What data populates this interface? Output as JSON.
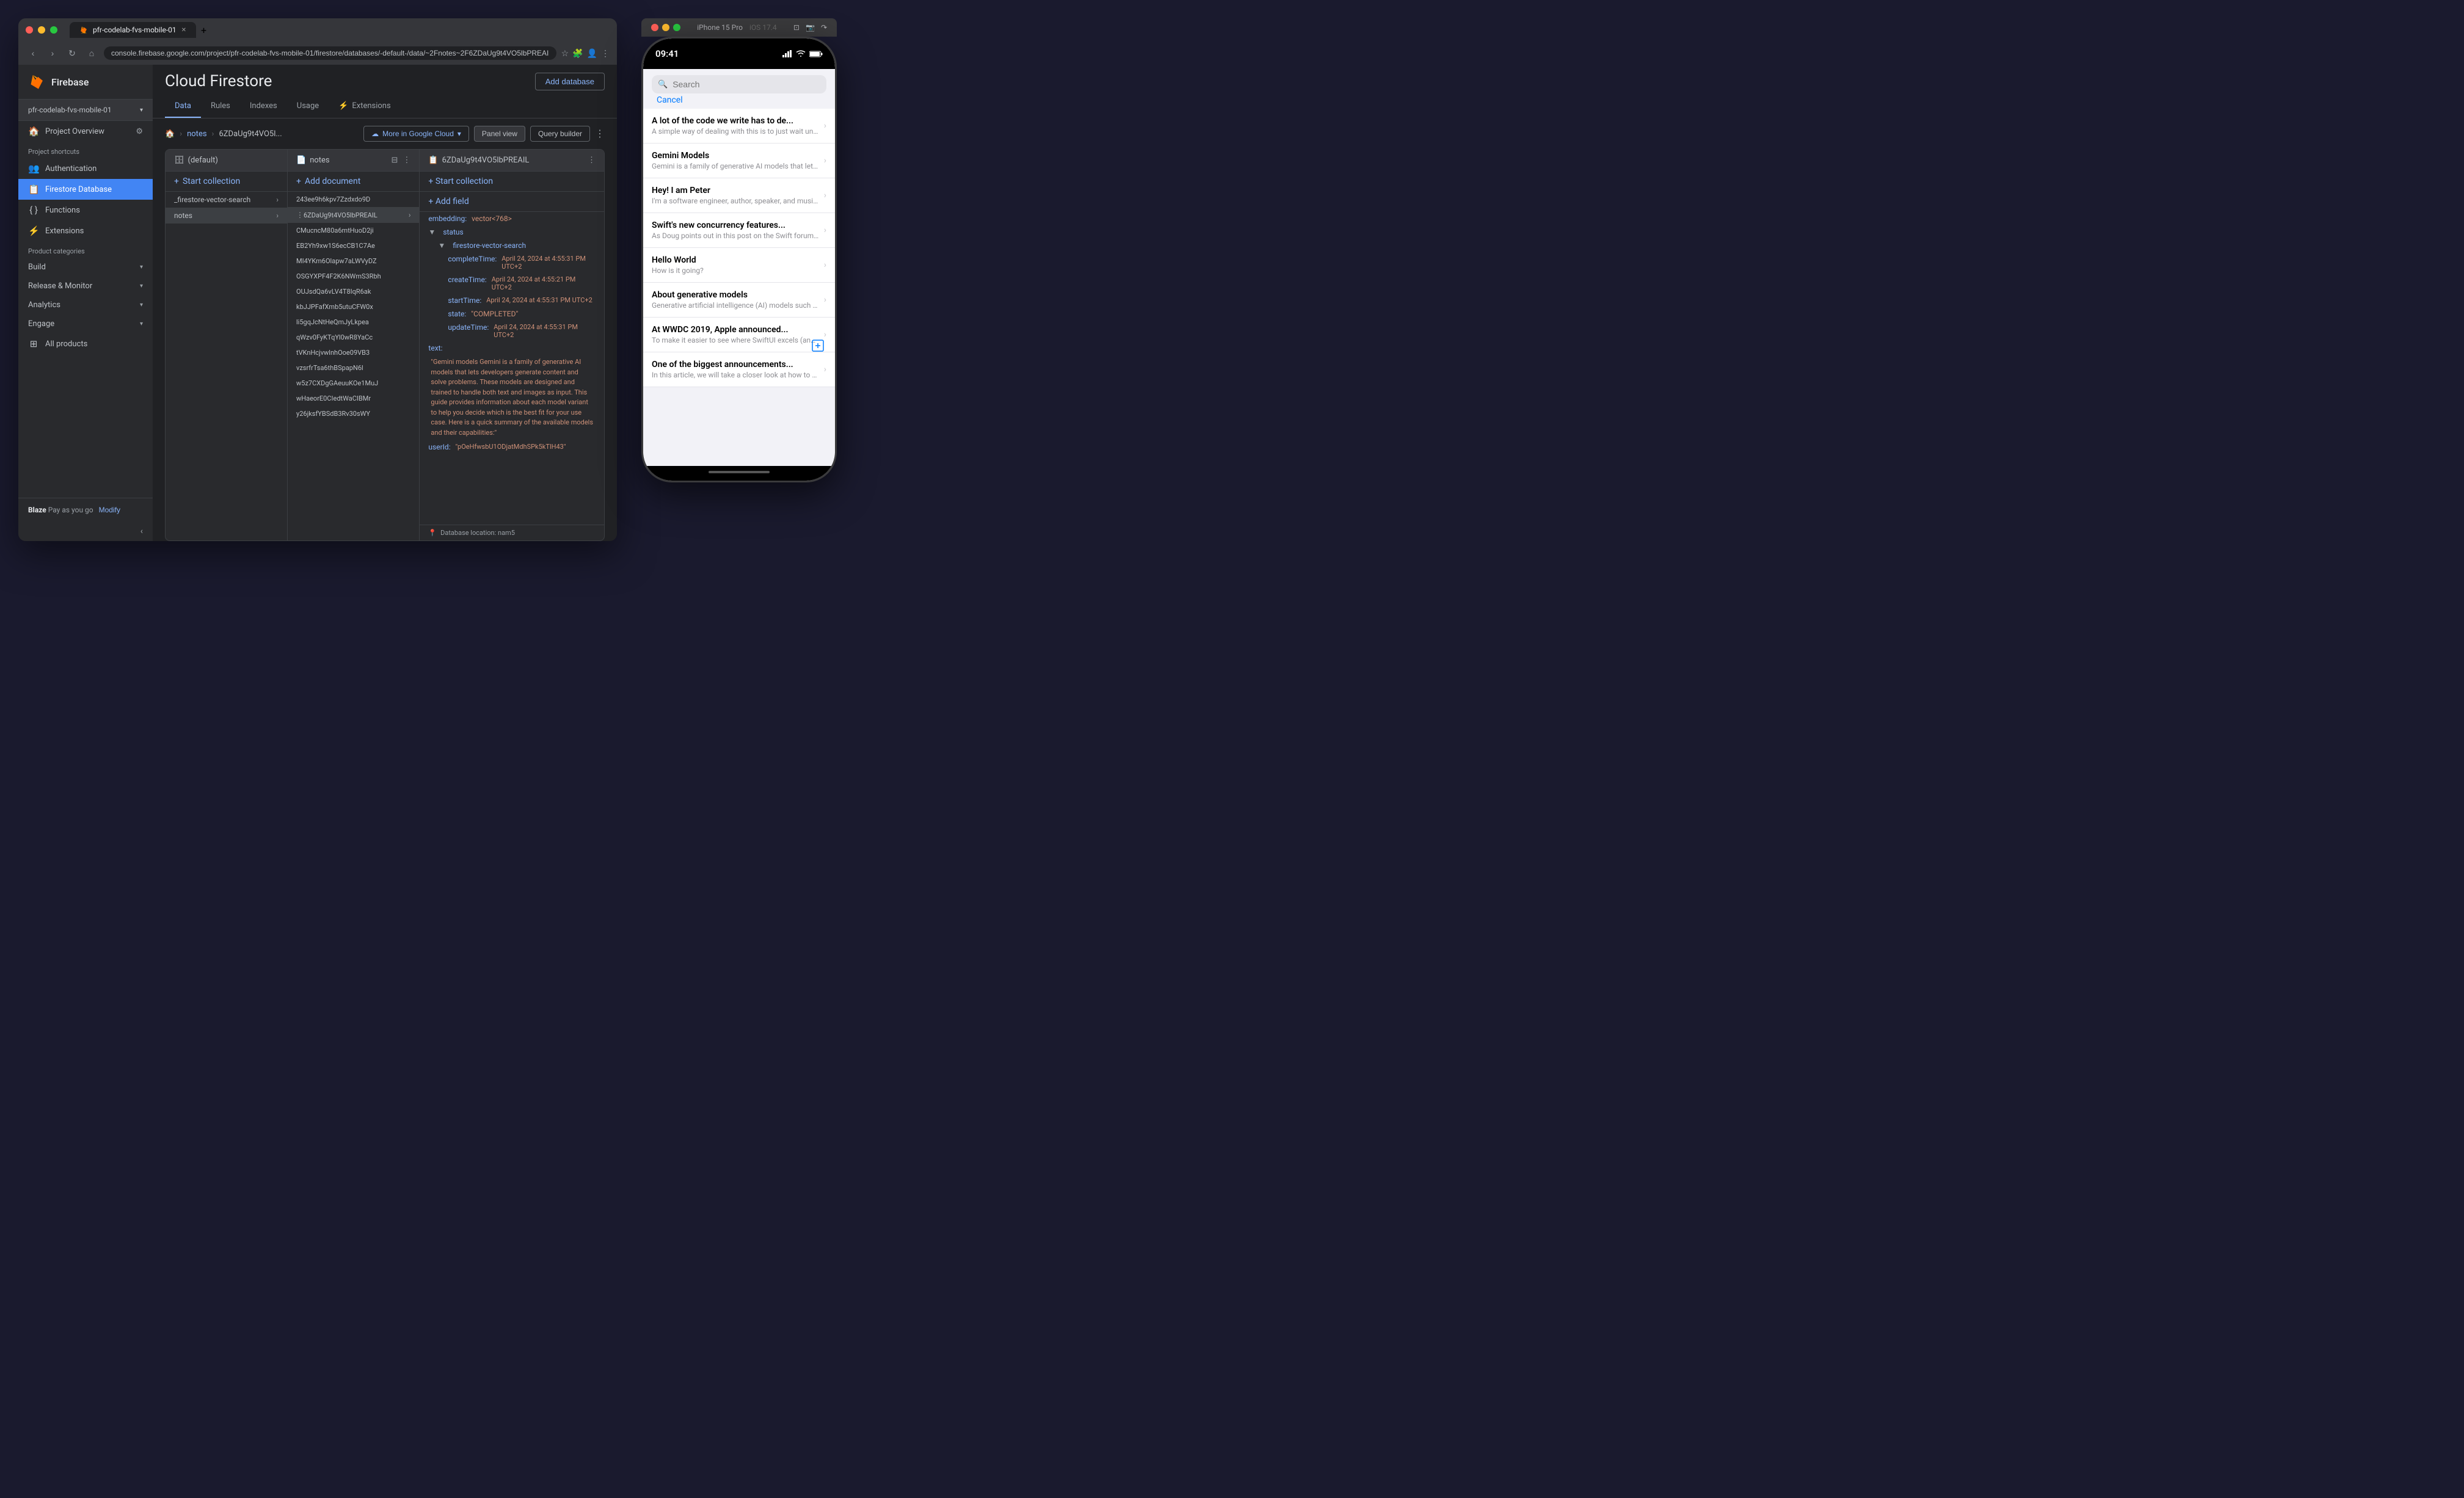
{
  "browser": {
    "tab_title": "pfr-codelab-fvs-mobile-01",
    "url": "console.firebase.google.com/project/pfr-codelab-fvs-mobile-01/firestore/databases/-default-/data/~2Fnotes~2F6ZDaUg9t4VO5lbPREAIL",
    "nav_back": "‹",
    "nav_forward": "›",
    "nav_refresh": "↻",
    "nav_home": "⌂"
  },
  "firebase": {
    "app_name": "Firebase",
    "project_name": "pfr-codelab-fvs-mobile-01",
    "page_title": "Cloud Firestore",
    "add_database_btn": "Add database",
    "sidebar": {
      "project_overview": "Project Overview",
      "section_shortcuts": "Project shortcuts",
      "authentication": "Authentication",
      "firestore_database": "Firestore Database",
      "functions": "Functions",
      "extensions": "Extensions",
      "section_categories": "Product categories",
      "build": "Build",
      "release_monitor": "Release & Monitor",
      "analytics": "Analytics",
      "engage": "Engage",
      "all_products": "All products"
    },
    "blaze_plan": "Blaze",
    "pay_as_you_go": "Pay as you go",
    "modify_btn": "Modify",
    "tabs": {
      "data": "Data",
      "rules": "Rules",
      "indexes": "Indexes",
      "usage": "Usage",
      "extensions": "Extensions"
    },
    "toolbar": {
      "panel_view": "Panel view",
      "query_builder": "Query builder",
      "more_google_cloud": "More in Google Cloud"
    },
    "breadcrumb": {
      "home": "🏠",
      "collection": "notes",
      "document": "6ZDaUg9t4VO5l..."
    },
    "panels": {
      "default": {
        "title": "(default)",
        "start_collection": "Start collection",
        "items": [
          "_firestore-vector-search",
          "notes"
        ]
      },
      "notes": {
        "title": "notes",
        "add_document": "Add document",
        "items": [
          "243ee9h6kpv7Zzdxdo9D",
          "6ZDaUg9t4VO5lbPREAIL",
          "CMucncM80a6mtHuoD2ji",
          "EB2Yh9xw1S6ecCB1C7Ae",
          "MI4YKm6Olapw7aLWVyDZ",
          "OSGYXPF4F2K6NWmS3Rbh",
          "OUJsdQa6vLV4T8IqR6ak",
          "kbJJPFafXmb5utuCFW0x",
          "li5gqJcNtHeQmJyLkpea",
          "qWzv0FyKTqYl0wR8YaCc",
          "tVKnHcjvwlnhOoe09VB3",
          "vzsrfrTsa6thBSpapN6l",
          "w5z7CXDgGAeuuKOe1MuJ",
          "wHaeorE0CIedtWaCIBMr",
          "y26jksfYBSdB3Rv30sWY"
        ]
      },
      "document": {
        "title": "6ZDaUg9t4VO5lbPREAIL",
        "add_field": "+ Add field",
        "start_collection": "+ Start collection",
        "fields": {
          "embedding": "vector<768>",
          "status": "",
          "firestore_vector_search": "",
          "completeTime": "April 24, 2024 at 4:55:31 PM UTC+2",
          "createTime": "April 24, 2024 at 4:55:21 PM UTC+2",
          "startTime": "April 24, 2024 at 4:55:31 PM UTC+2",
          "state": "\"COMPLETED\"",
          "updateTime": "April 24, 2024 at 4:55:31 PM UTC+2",
          "text": "\"Gemini models Gemini is a family of generative AI models that lets developers generate content and solve problems. These models are designed and trained to handle both text and images as input. This guide provides information about each model variant to help you decide which is the best fit for your use case. Here is a quick summary of the available models and their capabilities:\"",
          "userId": "\"pOeHfwsbU1ODjatMdhSPk5kTlH43\""
        }
      }
    },
    "status_bar": "Database location: nam5"
  },
  "iphone": {
    "title_bar_title": "iPhone 15 Pro",
    "ios_version": "iOS 17.4",
    "time": "09:41",
    "app": {
      "search_placeholder": "Search",
      "cancel_btn": "Cancel",
      "notes": [
        {
          "title": "A lot of the code we write has to de...",
          "preview": "A simple way of dealing with this is to just wait until a call has finished and..."
        },
        {
          "title": "Gemini Models",
          "preview": "Gemini is a family of generative AI models that lets developers generat..."
        },
        {
          "title": "Hey! I am Peter",
          "preview": "I'm a software engineer, author, speaker, and musician with a passion..."
        },
        {
          "title": "Swift's new concurrency features...",
          "preview": "As Doug points out in this post on the Swift forums, \"Swift has always been..."
        },
        {
          "title": "Hello World",
          "preview": "How is it going?"
        },
        {
          "title": "About generative models",
          "preview": "Generative artificial intelligence (AI) models such as the Gemini family of..."
        },
        {
          "title": "At WWDC 2019, Apple announced...",
          "preview": "To make it easier to see where SwiftUI excels (and where it falls short), let's..."
        },
        {
          "title": "One of the biggest announcements...",
          "preview": "In this article, we will take a closer look at how to use SwiftUI and Combine t..."
        }
      ]
    }
  }
}
